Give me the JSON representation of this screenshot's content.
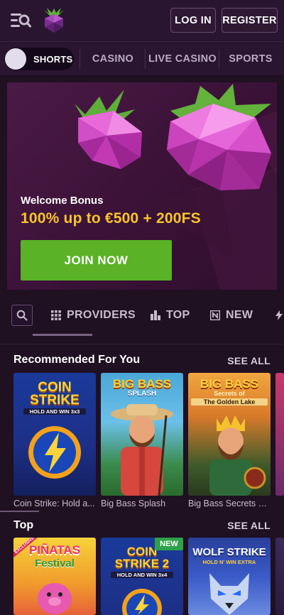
{
  "header": {
    "menu_icon": "menu-search-icon",
    "logo_icon": "raspberry-logo-icon",
    "login_label": "LOG IN",
    "register_label": "REGISTER"
  },
  "nav": {
    "shorts_label": "SHORTS",
    "items": [
      "CASINO",
      "LIVE CASINO",
      "SPORTS"
    ]
  },
  "banner": {
    "welcome": "Welcome Bonus",
    "offer": "100% up to €500 + 200FS",
    "cta": "JOIN NOW",
    "colors": {
      "offer": "#f7c52b",
      "cta": "#5ab226"
    }
  },
  "filters": {
    "search_icon": "search-icon",
    "items": [
      {
        "label": "PROVIDERS",
        "icon": "grid-icon"
      },
      {
        "label": "TOP",
        "icon": "podium-icon"
      },
      {
        "label": "NEW",
        "icon": "new-icon"
      },
      {
        "label": "",
        "icon": "lightning-icon"
      }
    ]
  },
  "sections": [
    {
      "title": "Recommended For You",
      "see_all": "SEE ALL",
      "games": [
        {
          "caption": "Coin Strike: Hold a...",
          "art": [
            "COIN",
            "STRIKE",
            "HOLD AND WIN 3x3"
          ]
        },
        {
          "caption": "Big Bass Splash",
          "art": [
            "BIG BASS",
            "SPLASH"
          ]
        },
        {
          "caption": "Big Bass Secrets of...",
          "art": [
            "BIG BASS",
            "Secrets of",
            "The Golden Lake"
          ]
        }
      ]
    },
    {
      "title": "Top",
      "see_all": "SEE ALL",
      "games": [
        {
          "caption": "",
          "art": [
            "PIÑATAS",
            "Festival",
            "EXCLUSIVE"
          ]
        },
        {
          "caption": "",
          "art": [
            "COIN",
            "STRIKE 2",
            "HOLD AND WIN 3x4"
          ],
          "badge": "NEW"
        },
        {
          "caption": "",
          "art": [
            "WOLF STRIKE",
            "HOLD N' WIN EXTRA"
          ]
        }
      ]
    }
  ]
}
